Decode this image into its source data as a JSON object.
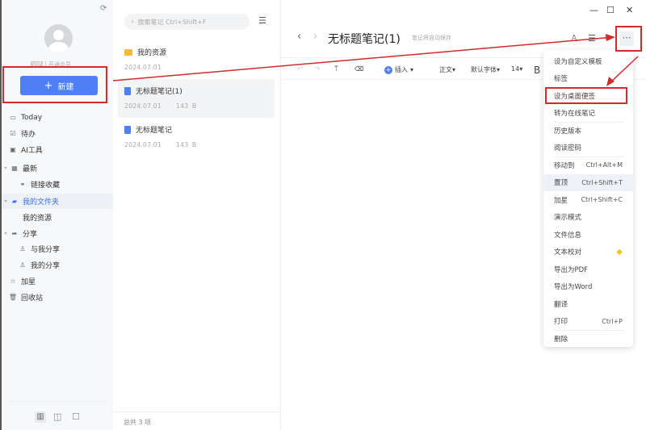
{
  "window": {
    "minimize": "—",
    "maximize": "☐",
    "close": "✕"
  },
  "sidebar": {
    "vip_badge": "VIP",
    "vip_link": "开通会员",
    "new_button": "新建",
    "items": [
      {
        "label": "Today",
        "icon": "calendar-icon"
      },
      {
        "label": "待办",
        "icon": "checkbox-icon"
      },
      {
        "label": "AI工具",
        "icon": "ai-icon"
      },
      {
        "label": "最新",
        "icon": "grid-icon"
      },
      {
        "label": "链接收藏",
        "icon": "link-icon"
      },
      {
        "label": "我的文件夹",
        "icon": "folder-icon",
        "active": true
      },
      {
        "label": "我的资源"
      },
      {
        "label": "分享",
        "icon": "share-icon"
      },
      {
        "label": "与我分享",
        "icon": "user-icon"
      },
      {
        "label": "我的分享",
        "icon": "user-icon"
      },
      {
        "label": "加星",
        "icon": "star-icon"
      },
      {
        "label": "回收站",
        "icon": "trash-icon"
      }
    ]
  },
  "list": {
    "search_placeholder": "搜索笔记 Ctrl+Shift+F",
    "items": [
      {
        "title": "我的资源",
        "date": "2024.07.01",
        "size": "",
        "type": "folder"
      },
      {
        "title": "无标题笔记(1)",
        "date": "2024.07.01",
        "size": "143 B",
        "type": "note",
        "selected": true
      },
      {
        "title": "无标题笔记",
        "date": "2024.07.01",
        "size": "143 B",
        "type": "note"
      }
    ],
    "footer": "总共 3 项"
  },
  "editor": {
    "title": "无标题笔记(1)",
    "autosave": "笔记将自动保存",
    "toolbar": {
      "insert": "插入",
      "style": "正文",
      "font": "默认字体",
      "size": "14",
      "bold": "B"
    }
  },
  "menu": {
    "items": [
      {
        "label": "设为自定义模板"
      },
      {
        "label": "标签"
      },
      {
        "label": "设为桌面便签",
        "boxed": true
      },
      {
        "label": "转为在线笔记"
      },
      {
        "label": "历史版本"
      },
      {
        "label": "阅读密码"
      },
      {
        "label": "移动到",
        "shortcut": "Ctrl+Alt+M"
      },
      {
        "label": "置顶",
        "shortcut": "Ctrl+Shift+T",
        "highlighted": true
      },
      {
        "label": "加星",
        "shortcut": "Ctrl+Shift+C"
      },
      {
        "label": "演示模式"
      },
      {
        "label": "文件信息"
      },
      {
        "label": "文本校对",
        "badge": "vip-diamond-icon"
      },
      {
        "label": "导出为PDF"
      },
      {
        "label": "导出为Word"
      },
      {
        "label": "翻译"
      },
      {
        "label": "打印",
        "shortcut": "Ctrl+P"
      },
      {
        "label": "删除"
      }
    ]
  },
  "colors": {
    "accent": "#4e7ff5",
    "annotation": "#d42a2a",
    "vip": "#f5c518"
  }
}
